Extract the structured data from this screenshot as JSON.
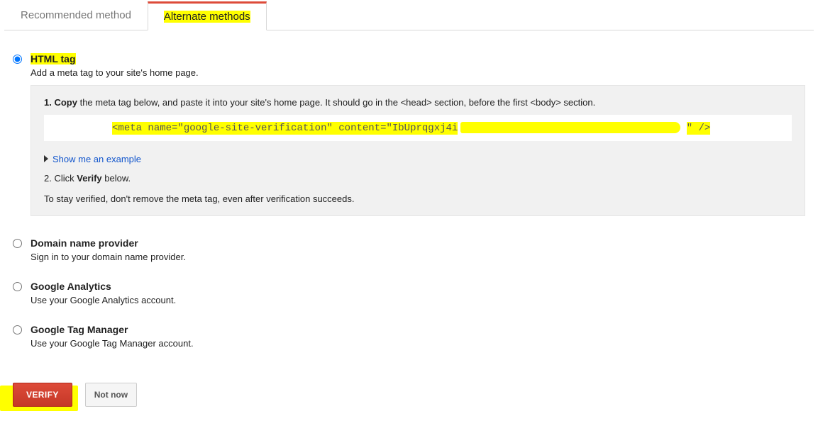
{
  "tabs": {
    "recommended": "Recommended method",
    "alternate": "Alternate methods"
  },
  "options": {
    "html_tag": {
      "title": "HTML tag",
      "desc": "Add a meta tag to your site's home page."
    },
    "domain": {
      "title": "Domain name provider",
      "desc": "Sign in to your domain name provider."
    },
    "ga": {
      "title": "Google Analytics",
      "desc": "Use your Google Analytics account."
    },
    "gtm": {
      "title": "Google Tag Manager",
      "desc": "Use your Google Tag Manager account."
    }
  },
  "detail": {
    "step1_pre": "1. Copy",
    "step1_rest": " the meta tag below, and paste it into your site's home page. It should go in the <head> section, before the first <body> section.",
    "code_visible": "<meta name=\"google-site-verification\" content=\"IbUprqgxj4i",
    "code_end": "\" />",
    "example": "Show me an example",
    "step2_pre": "2. Click ",
    "step2_bold": "Verify",
    "step2_post": " below.",
    "stay": "To stay verified, don't remove the meta tag, even after verification succeeds."
  },
  "actions": {
    "verify": "VERIFY",
    "not_now": "Not now"
  }
}
